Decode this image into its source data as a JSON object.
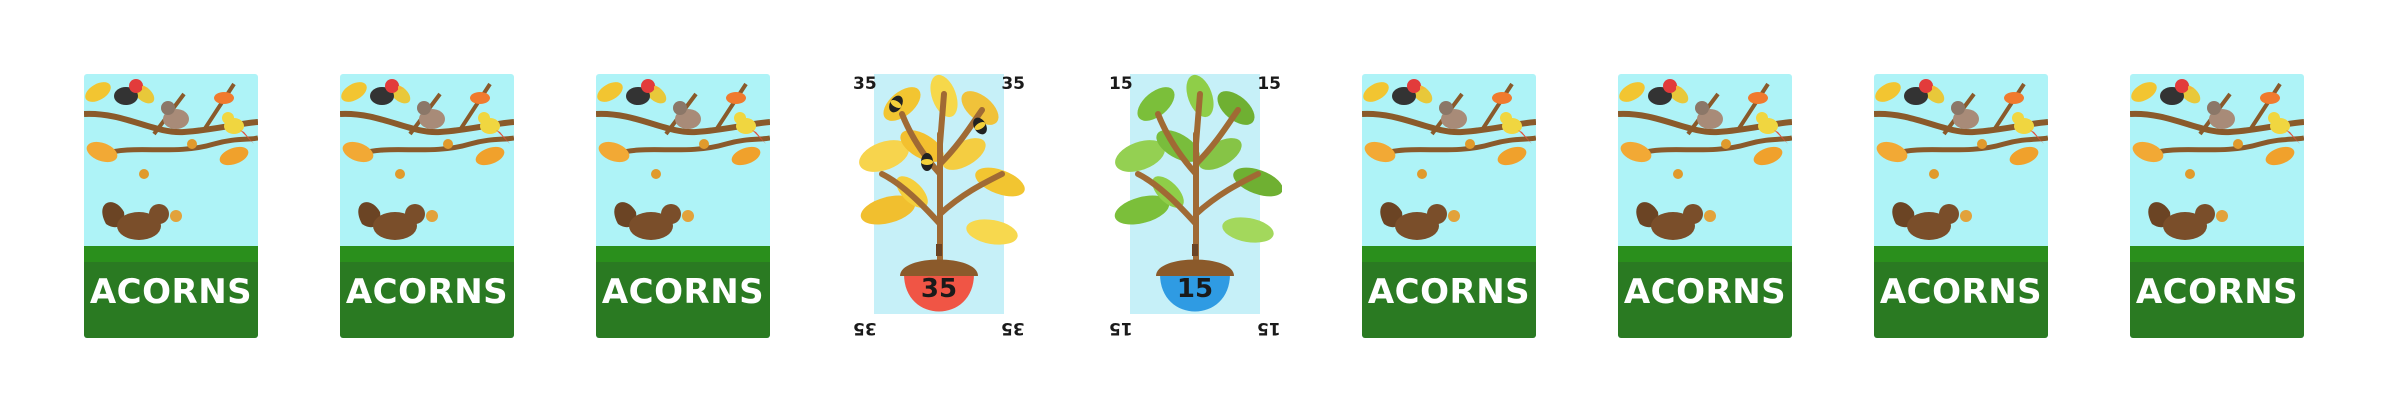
{
  "card_backs": [
    {
      "title": "ACORNS"
    },
    {
      "title": "ACORNS"
    },
    {
      "title": "ACORNS"
    },
    {
      "title": "ACORNS"
    },
    {
      "title": "ACORNS"
    },
    {
      "title": "ACORNS"
    },
    {
      "title": "ACORNS"
    }
  ],
  "card_faces": [
    {
      "value": "35",
      "leaf_theme": "yellow",
      "acorn_cap_color": "#f05545",
      "has_bees": true
    },
    {
      "value": "15",
      "leaf_theme": "green",
      "acorn_cap_color": "#2f9be3",
      "has_bees": false
    }
  ],
  "colors": {
    "back_sky": "#aef3f7",
    "back_grass": "#2c7a1c",
    "back_title_band": "#2a7a22",
    "face_sky": "#c6f0f8"
  },
  "icons": [
    "squirrel-icon",
    "cardinal-icon",
    "sparrow-icon",
    "yellow-bird-icon",
    "acorn-icon",
    "oak-leaf-icon",
    "bee-icon"
  ]
}
